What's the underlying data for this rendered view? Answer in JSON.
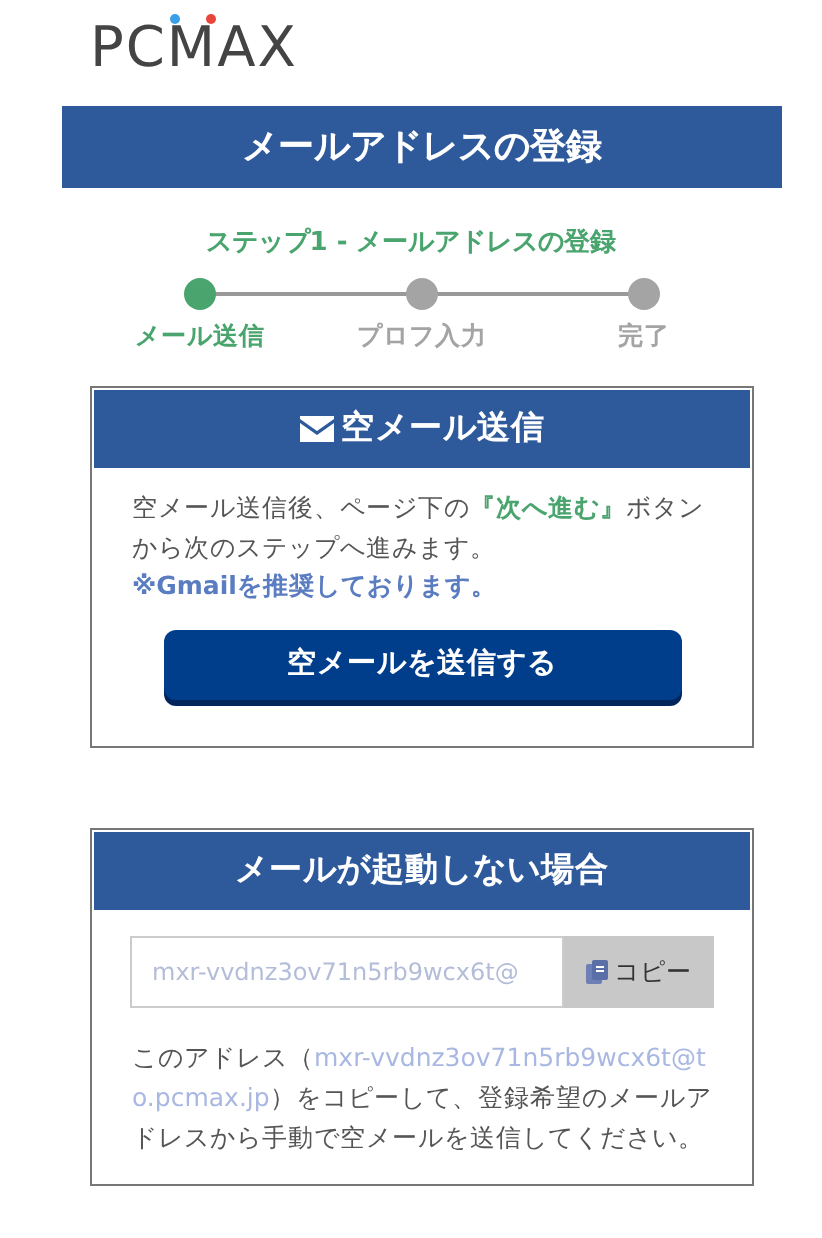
{
  "logo": {
    "text": "PCMAX"
  },
  "page_title": "メールアドレスの登録",
  "step_heading": "ステップ1 - メールアドレスの登録",
  "steps": [
    {
      "label": "メール送信",
      "selected": true
    },
    {
      "label": "プロフ入力",
      "selected": false
    },
    {
      "label": "完了",
      "selected": false
    }
  ],
  "send_card": {
    "title": "空メール送信",
    "description": [
      {
        "text": "空メール送信後、ページ下の",
        "highlight": false
      },
      {
        "text": "『次へ進む』",
        "highlight": true
      },
      {
        "text": "ボタンから次のステップへ進みます。",
        "highlight": false
      }
    ],
    "note": "※Gmailを推奨しております。",
    "button": "空メールを送信する"
  },
  "fallback_card": {
    "title": "メールが起動しない場合",
    "address_field": {
      "value": "mxr-vvdnz3ov71n5rb9wcx6t@"
    },
    "copy_button": "コピー",
    "description": [
      {
        "text": "このアドレス（",
        "highlight": false
      },
      {
        "text": "mxr-vvdnz3ov71n5rb9wcx6t@to.pcmax.jp",
        "highlight": true
      },
      {
        "text": "）をコピーして、登録希望のメールアドレスから手動で空メールを送信してください。",
        "highlight": false
      }
    ]
  }
}
